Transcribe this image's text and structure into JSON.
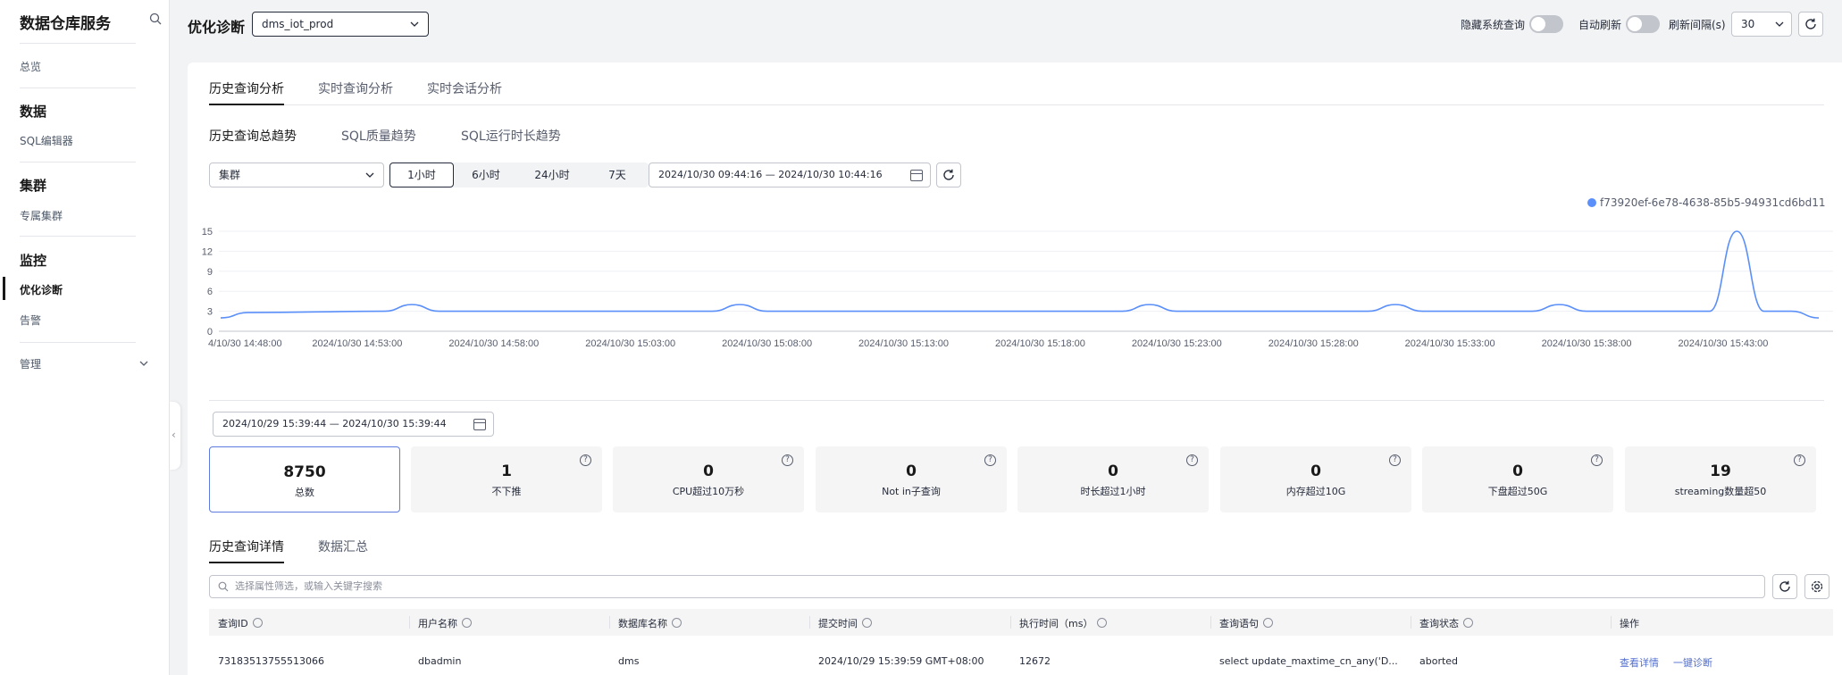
{
  "sidebar": {
    "title": "数据仓库服务",
    "overview": "总览",
    "groups": [
      {
        "title": "数据",
        "items": [
          "SQL编辑器"
        ]
      },
      {
        "title": "集群",
        "items": [
          "专属集群"
        ]
      },
      {
        "title": "监控",
        "items": [
          "优化诊断",
          "告警"
        ]
      }
    ],
    "manage": "管理"
  },
  "header": {
    "title": "优化诊断",
    "database": "dms_iot_prod",
    "hide_system_query": "隐藏系统查询",
    "auto_refresh": "自动刷新",
    "refresh_interval_label": "刷新间隔(s)",
    "refresh_interval": "30"
  },
  "tabs": [
    "历史查询分析",
    "实时查询分析",
    "实时会话分析"
  ],
  "subtabs": [
    "历史查询总趋势",
    "SQL质量趋势",
    "SQL运行时长趋势"
  ],
  "filters": {
    "cluster_select": "集群",
    "ranges": [
      "1小时",
      "6小时",
      "24小时",
      "7天"
    ],
    "active_range": "1小时",
    "date_range": "2024/10/30 09:44:16 — 2024/10/30 10:44:16"
  },
  "chart_data": {
    "type": "line",
    "series": [
      {
        "name": "f73920ef-6e78-4638-85b5-94931cd6bd11"
      }
    ],
    "yticks": [
      0,
      3,
      6,
      9,
      12,
      15
    ],
    "ylim": [
      0,
      15
    ],
    "xticks": [
      "4/10/30 14:48:00",
      "2024/10/30 14:53:00",
      "2024/10/30 14:58:00",
      "2024/10/30 15:03:00",
      "2024/10/30 15:08:00",
      "2024/10/30 15:13:00",
      "2024/10/30 15:18:00",
      "2024/10/30 15:23:00",
      "2024/10/30 15:28:00",
      "2024/10/30 15:33:00",
      "2024/10/30 15:38:00",
      "2024/10/30 15:43:00"
    ],
    "xlim_minutes": [
      0,
      58.5
    ],
    "points": [
      [
        0,
        2
      ],
      [
        1,
        2.8
      ],
      [
        6,
        3
      ],
      [
        7,
        4
      ],
      [
        8,
        3
      ],
      [
        18,
        3
      ],
      [
        19,
        4
      ],
      [
        20,
        3
      ],
      [
        33,
        3
      ],
      [
        34,
        4
      ],
      [
        35,
        3
      ],
      [
        42,
        3
      ],
      [
        43,
        4
      ],
      [
        44,
        3
      ],
      [
        48,
        3
      ],
      [
        49,
        4
      ],
      [
        50,
        3
      ],
      [
        54.5,
        3
      ],
      [
        55.5,
        15
      ],
      [
        56.5,
        3
      ],
      [
        57.5,
        3
      ],
      [
        58.5,
        2
      ]
    ]
  },
  "stats_range": "2024/10/29 15:39:44 — 2024/10/30 15:39:44",
  "stats": [
    {
      "value": "8750",
      "label": "总数"
    },
    {
      "value": "1",
      "label": "不下推"
    },
    {
      "value": "0",
      "label": "CPU超过10万秒"
    },
    {
      "value": "0",
      "label": "Not in子查询"
    },
    {
      "value": "0",
      "label": "时长超过1小时"
    },
    {
      "value": "0",
      "label": "内存超过10G"
    },
    {
      "value": "0",
      "label": "下盘超过50G"
    },
    {
      "value": "19",
      "label": "streaming数量超50"
    }
  ],
  "detail_tabs": [
    "历史查询详情",
    "数据汇总"
  ],
  "search_placeholder": "选择属性筛选，或输入关键字搜索",
  "table": {
    "columns": [
      "查询ID",
      "用户名称",
      "数据库名称",
      "提交时间",
      "执行时间（ms）",
      "查询语句",
      "查询状态",
      "操作"
    ],
    "rows": [
      {
        "id": "73183513755513066",
        "user": "dbadmin",
        "db": "dms",
        "time": "2024/10/29 15:39:59 GMT+08:00",
        "duration": "12672",
        "sql": "select update_maxtime_cn_any('D...",
        "status": "aborted",
        "actions": [
          "查看详情",
          "一键诊断"
        ]
      }
    ]
  }
}
